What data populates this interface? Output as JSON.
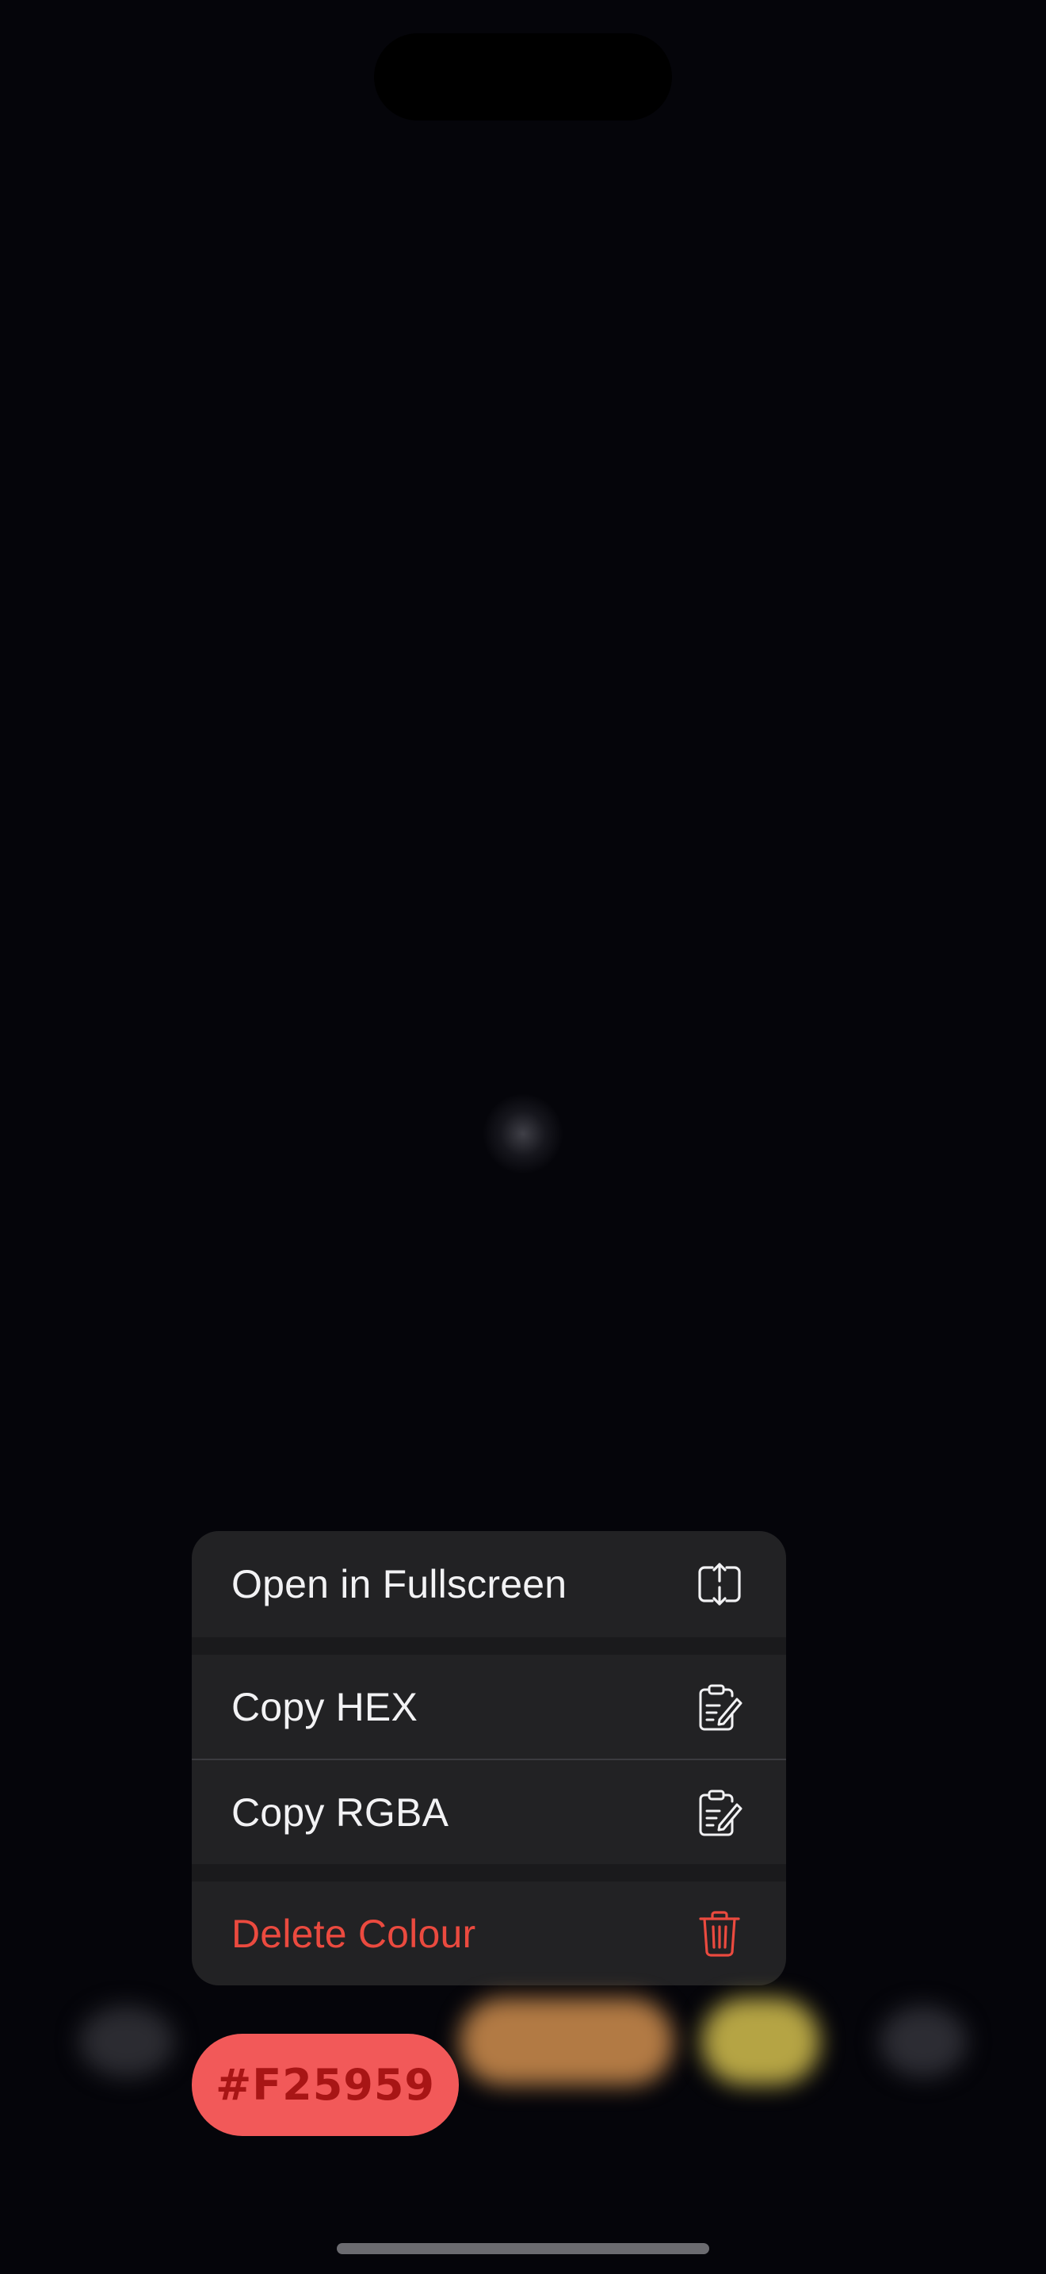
{
  "menu": {
    "items": [
      {
        "label": "Open in Fullscreen",
        "icon": "fullscreen-arrows-icon"
      },
      {
        "label": "Copy HEX",
        "icon": "clipboard-edit-icon"
      },
      {
        "label": "Copy RGBA",
        "icon": "clipboard-edit-icon"
      },
      {
        "label": "Delete Colour",
        "icon": "trash-icon",
        "destructive": true
      }
    ]
  },
  "selected_colour": {
    "hex_label": "#F25959",
    "fill": "#F25959"
  },
  "colors": {
    "background": "#05050A",
    "menu_background": "#222224",
    "destructive": "#EB4A3F",
    "swatches": [
      "#2B2B31",
      "#B27A44",
      "#B5A444",
      "#2C2C33"
    ]
  }
}
